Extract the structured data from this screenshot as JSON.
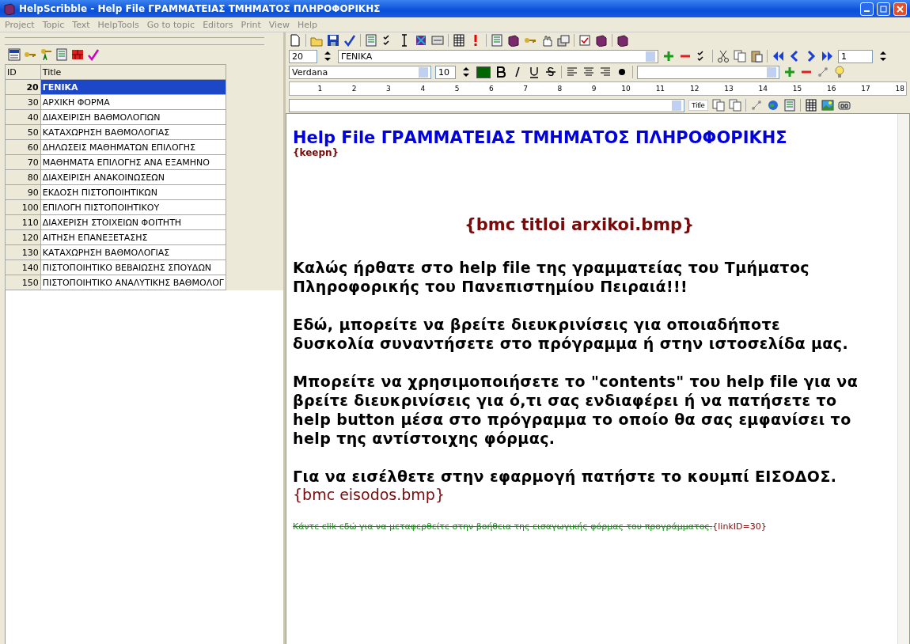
{
  "window": {
    "title": "HelpScribble - Help File ΓΡΑΜΜΑΤΕΙΑΣ ΤΜΗΜΑΤΟΣ ΠΛΗΡΟΦΟΡΙΚΗΣ"
  },
  "menu": [
    "Project",
    "Topic",
    "Text",
    "HelpTools",
    "Go to topic",
    "Editors",
    "Print",
    "View",
    "Help"
  ],
  "topics": {
    "columns": [
      "ID",
      "Title"
    ],
    "rows": [
      {
        "id": "20",
        "title": "ΓΕΝΙΚΑ",
        "selected": true
      },
      {
        "id": "30",
        "title": "ΑΡΧΙΚΗ ΦΟΡΜΑ",
        "selected": false
      },
      {
        "id": "40",
        "title": "ΔΙΑΧΕΙΡΙΣΗ ΒΑΘΜΟΛΟΓΙΩΝ",
        "selected": false
      },
      {
        "id": "50",
        "title": "ΚΑΤΑΧΩΡΗΣΗ ΒΑΘΜΟΛΟΓΙΑΣ",
        "selected": false
      },
      {
        "id": "60",
        "title": "ΔΗΛΩΣΕΙΣ ΜΑΘΗΜΑΤΩΝ ΕΠΙΛΟΓΗΣ",
        "selected": false
      },
      {
        "id": "70",
        "title": "ΜΑΘΗΜΑΤΑ ΕΠΙΛΟΓΗΣ ΑΝΑ ΕΞΑΜΗΝΟ",
        "selected": false
      },
      {
        "id": "80",
        "title": "ΔΙΑΧΕΙΡΙΣΗ ΑΝΑΚΟΙΝΩΣΕΩΝ",
        "selected": false
      },
      {
        "id": "90",
        "title": "ΕΚΔΟΣΗ ΠΙΣΤΟΠΟΙΗΤΙΚΩΝ",
        "selected": false
      },
      {
        "id": "100",
        "title": "ΕΠΙΛΟΓΗ ΠΙΣΤΟΠΟΙΗΤΙΚΟΥ",
        "selected": false
      },
      {
        "id": "110",
        "title": "ΔΙΑΧΕΡΙΣΗ ΣΤΟΙΧΕΙΩΝ ΦΟΙΤΗΤΗ",
        "selected": false
      },
      {
        "id": "120",
        "title": "ΑΙΤΗΣΗ ΕΠΑΝΕΞΕΤΑΣΗΣ",
        "selected": false
      },
      {
        "id": "130",
        "title": "ΚΑΤΑΧΩΡΗΣΗ ΒΑΘΜΟΛΟΓΙΑΣ",
        "selected": false
      },
      {
        "id": "140",
        "title": "ΠΙΣΤΟΠΟΙΗΤΙΚΟ ΒΕΒΑΙΩΣΗΣ ΣΠΟΥΔΩΝ",
        "selected": false
      },
      {
        "id": "150",
        "title": "ΠΙΣΤΟΠΟΙΗΤΙΚΟ ΑΝΑΛΥΤΙΚΗΣ ΒΑΘΜΟΛΟΓ",
        "selected": false
      }
    ]
  },
  "topic_bar": {
    "id": "20",
    "title": "ΓΕΝΙΚΑ",
    "page": "1"
  },
  "format_bar": {
    "font": "Verdana",
    "size": "10",
    "color": "#006600"
  },
  "ruler": [
    "1",
    "2",
    "3",
    "4",
    "5",
    "6",
    "7",
    "8",
    "9",
    "10",
    "11",
    "12",
    "13",
    "14",
    "15",
    "16",
    "17",
    "18"
  ],
  "keyword_bar": {
    "title_button": "Title"
  },
  "document": [
    {
      "kind": "heading",
      "text": "Help File ΓΡΑΜΜΑΤΕΙΑΣ ΤΜΗΜΑΤΟΣ ΠΛΗΡΟΦΟΡΙΚΗΣ"
    },
    {
      "kind": "code",
      "text": "{keepn}"
    },
    {
      "kind": "center-code",
      "text": "{bmc titloi arxikoi.bmp}"
    },
    {
      "kind": "para",
      "text": "Καλώς ήρθατε στο help file της γραμματείας του Τμήματος Πληροφορικής του Πανεπιστημίου Πειραιά!!!"
    },
    {
      "kind": "para",
      "text": "Εδώ, μπορείτε να βρείτε διευκρινίσεις για οποιαδήποτε δυσκολία συναντήσετε στο πρόγραμμα ή στην ιστοσελίδα μας."
    },
    {
      "kind": "para",
      "text": "Μπορείτε να χρησιμοποιήσετε το \"contents\" του help file για να βρείτε διευκρινίσεις για ό,τι σας ενδιαφέρει ή να πατήσετε το help button μέσα στο πρόγραμμα το οποίο θα σας εμφανίσει το help της αντίστοιχης φόρμας."
    },
    {
      "kind": "para-tight",
      "text": "Για να εισέλθετε στην εφαρμογή πατήστε το κουμπί ΕΙΣΟΔΟΣ."
    },
    {
      "kind": "inline-code",
      "text": "{bmc eisodos.bmp}"
    },
    {
      "kind": "link",
      "text": "Κάντε clik εδώ για να μεταφερθείτε στην βοήθεια της εισαγωγικής φόρμας του προγράμματος.",
      "code": "{linkID=30}"
    }
  ]
}
